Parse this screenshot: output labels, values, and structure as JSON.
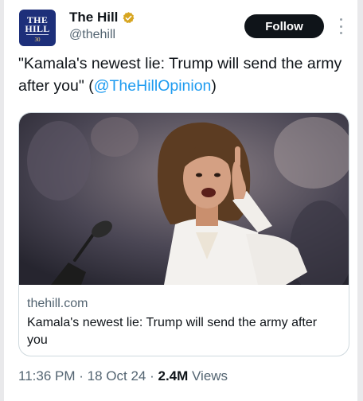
{
  "account": {
    "display_name": "The Hill",
    "handle": "@thehill",
    "logo_line1": "THE",
    "logo_line2": "HILL",
    "logo_sub": "30",
    "follow_label": "Follow"
  },
  "tweet": {
    "text_before": "\"Kamala's newest lie: Trump will send the army after you\" (",
    "mention": "@TheHillOpinion",
    "text_after": ")"
  },
  "card": {
    "domain": "thehill.com",
    "title": "Kamala's newest lie: Trump will send the army after you"
  },
  "meta": {
    "time": "11:36 PM",
    "date": "18 Oct 24",
    "views_count": "2.4M",
    "views_label": "Views"
  },
  "colors": {
    "accent": "#1d9bf0",
    "verified_gold": "#d7a520",
    "logo_bg": "#1d2f7a",
    "follow_bg": "#0f1419"
  },
  "icons": [
    "verified-badge-icon",
    "more-options-icon"
  ]
}
